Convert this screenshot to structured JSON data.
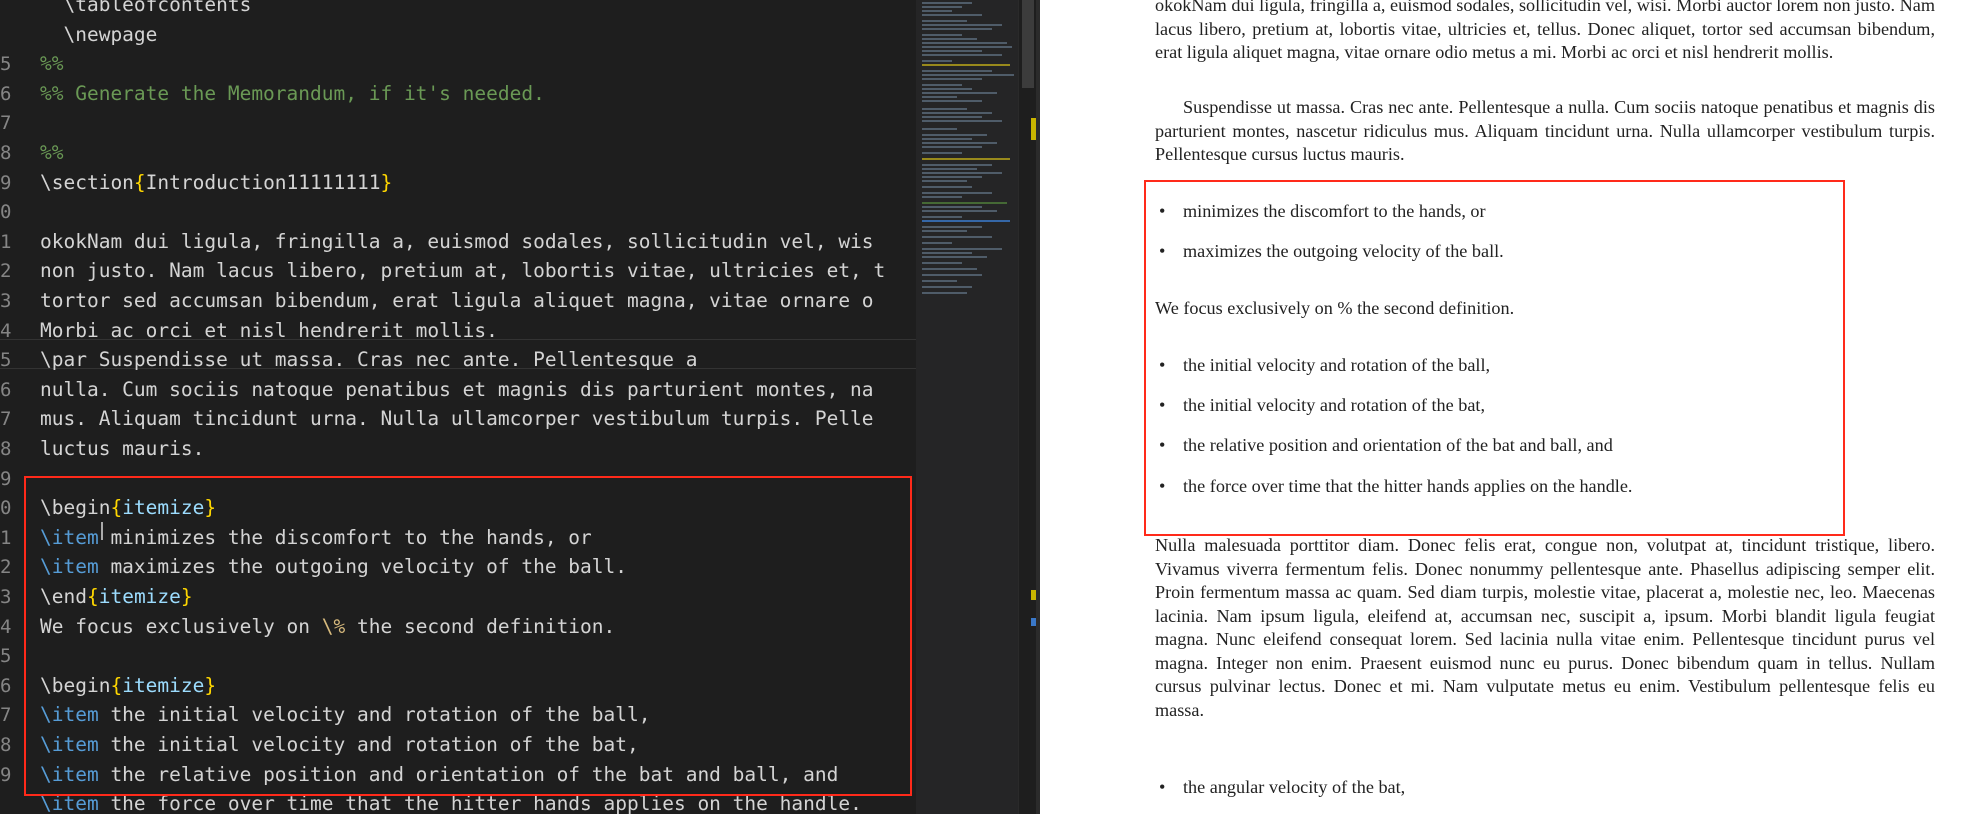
{
  "editor": {
    "lines": [
      {
        "num": "",
        "text": "  \\tableofcontents"
      },
      {
        "num": "",
        "text": "  \\newpage"
      },
      {
        "num": "5",
        "text": "%%"
      },
      {
        "num": "6",
        "text": "%% Generate the Memorandum, if it's needed."
      },
      {
        "num": "7",
        "text": ""
      },
      {
        "num": "8",
        "text": "%%"
      },
      {
        "num": "9",
        "text": "\\section{Introduction11111111}"
      },
      {
        "num": "0",
        "text": ""
      },
      {
        "num": "1",
        "text": "okokNam dui ligula, fringilla a, euismod sodales, sollicitudin vel, wis"
      },
      {
        "num": "2",
        "text": "non justo. Nam lacus libero, pretium at, lobortis vitae, ultricies et, t"
      },
      {
        "num": "3",
        "text": "tortor sed accumsan bibendum, erat ligula aliquet magna, vitae ornare o"
      },
      {
        "num": "4",
        "text": "Morbi ac orci et nisl hendrerit mollis."
      },
      {
        "num": "5",
        "text": "\\par Suspendisse ut massa. Cras nec ante. Pellentesque a"
      },
      {
        "num": "6",
        "text": "nulla. Cum sociis natoque penatibus et magnis dis parturient montes, na"
      },
      {
        "num": "7",
        "text": "mus. Aliquam tincidunt urna. Nulla ullamcorper vestibulum turpis. Pelle"
      },
      {
        "num": "8",
        "text": "luctus mauris."
      },
      {
        "num": "9",
        "text": ""
      },
      {
        "num": "0",
        "text": "\\begin{itemize}"
      },
      {
        "num": "1",
        "text": "\\item minimizes the discomfort to the hands, or"
      },
      {
        "num": "2",
        "text": "\\item maximizes the outgoing velocity of the ball."
      },
      {
        "num": "3",
        "text": "\\end{itemize}"
      },
      {
        "num": "4",
        "text": "We focus exclusively on \\% the second definition."
      },
      {
        "num": "5",
        "text": ""
      },
      {
        "num": "6",
        "text": "\\begin{itemize}"
      },
      {
        "num": "7",
        "text": "\\item the initial velocity and rotation of the ball,"
      },
      {
        "num": "8",
        "text": "\\item the initial velocity and rotation of the bat,"
      },
      {
        "num": "9",
        "text": "\\item the relative position and orientation of the bat and ball, and"
      },
      {
        "num": "",
        "text": "\\item the force over time that the hitter hands applies on the handle."
      }
    ]
  },
  "pdf": {
    "para_top": "okokNam dui ligula, fringilla a, euismod sodales, sollicitudin vel, wisi. Morbi auctor lorem non justo. Nam lacus libero, pretium at, lobortis vitae, ultricies et, tellus. Donec aliquet, tortor sed accumsan bibendum, erat ligula aliquet magna, vitae ornare odio metus a mi. Morbi ac orci et nisl hendrerit mollis.",
    "para_suspendisse": "Suspendisse ut massa. Cras nec ante. Pellentesque a nulla. Cum sociis natoque penatibus et magnis dis parturient montes, nascetur ridiculus mus. Aliquam tincidunt urna. Nulla ullamcorper vestibulum turpis. Pellentesque cursus luctus mauris.",
    "bullets_a": [
      "minimizes the discomfort to the hands, or",
      "maximizes the outgoing velocity of the ball."
    ],
    "focus_line": "We focus exclusively on % the second definition.",
    "bullets_b": [
      "the initial velocity and rotation of the ball,",
      "the initial velocity and rotation of the bat,",
      "the relative position and orientation of the bat and ball, and",
      "the force over time that the hitter hands applies on the handle."
    ],
    "para_nulla": "Nulla malesuada porttitor diam. Donec felis erat, congue non, volutpat at, tincidunt tristique, libero. Vivamus viverra fermentum felis. Donec nonummy pellentesque ante. Phasellus adipiscing semper elit. Proin fermentum massa ac quam. Sed diam turpis, molestie vitae, placerat a, molestie nec, leo. Maecenas lacinia. Nam ipsum ligula, eleifend at, accumsan nec, suscipit a, ipsum. Morbi blandit ligula feugiat magna. Nunc eleifend consequat lorem. Sed lacinia nulla vitae enim. Pellentesque tincidunt purus vel magna. Integer non enim. Praesent euismod nunc eu purus. Donec bibendum quam in tellus. Nullam cursus pulvinar lectus. Donec et mi. Nam vulputate metus eu enim. Vestibulum pellentesque felis eu massa.",
    "bullet_last": "the angular velocity of the bat,"
  },
  "colors": {
    "editor_bg": "#1e1e1e",
    "highlight_box": "#ff2a1a",
    "pdf_bg": "#ffffff"
  }
}
